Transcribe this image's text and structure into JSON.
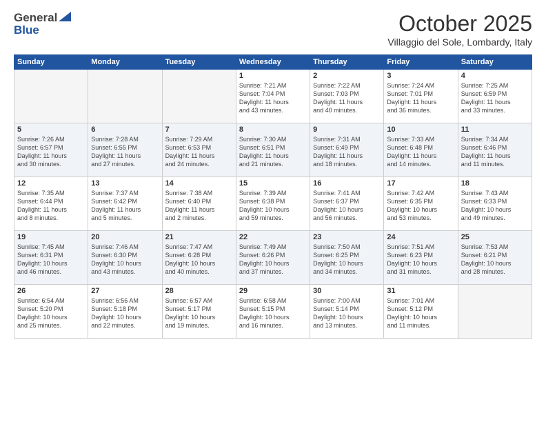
{
  "logo": {
    "line1": "General",
    "line2": "Blue"
  },
  "title": "October 2025",
  "subtitle": "Villaggio del Sole, Lombardy, Italy",
  "headers": [
    "Sunday",
    "Monday",
    "Tuesday",
    "Wednesday",
    "Thursday",
    "Friday",
    "Saturday"
  ],
  "weeks": [
    [
      {
        "num": "",
        "info": ""
      },
      {
        "num": "",
        "info": ""
      },
      {
        "num": "",
        "info": ""
      },
      {
        "num": "1",
        "info": "Sunrise: 7:21 AM\nSunset: 7:04 PM\nDaylight: 11 hours\nand 43 minutes."
      },
      {
        "num": "2",
        "info": "Sunrise: 7:22 AM\nSunset: 7:03 PM\nDaylight: 11 hours\nand 40 minutes."
      },
      {
        "num": "3",
        "info": "Sunrise: 7:24 AM\nSunset: 7:01 PM\nDaylight: 11 hours\nand 36 minutes."
      },
      {
        "num": "4",
        "info": "Sunrise: 7:25 AM\nSunset: 6:59 PM\nDaylight: 11 hours\nand 33 minutes."
      }
    ],
    [
      {
        "num": "5",
        "info": "Sunrise: 7:26 AM\nSunset: 6:57 PM\nDaylight: 11 hours\nand 30 minutes."
      },
      {
        "num": "6",
        "info": "Sunrise: 7:28 AM\nSunset: 6:55 PM\nDaylight: 11 hours\nand 27 minutes."
      },
      {
        "num": "7",
        "info": "Sunrise: 7:29 AM\nSunset: 6:53 PM\nDaylight: 11 hours\nand 24 minutes."
      },
      {
        "num": "8",
        "info": "Sunrise: 7:30 AM\nSunset: 6:51 PM\nDaylight: 11 hours\nand 21 minutes."
      },
      {
        "num": "9",
        "info": "Sunrise: 7:31 AM\nSunset: 6:49 PM\nDaylight: 11 hours\nand 18 minutes."
      },
      {
        "num": "10",
        "info": "Sunrise: 7:33 AM\nSunset: 6:48 PM\nDaylight: 11 hours\nand 14 minutes."
      },
      {
        "num": "11",
        "info": "Sunrise: 7:34 AM\nSunset: 6:46 PM\nDaylight: 11 hours\nand 11 minutes."
      }
    ],
    [
      {
        "num": "12",
        "info": "Sunrise: 7:35 AM\nSunset: 6:44 PM\nDaylight: 11 hours\nand 8 minutes."
      },
      {
        "num": "13",
        "info": "Sunrise: 7:37 AM\nSunset: 6:42 PM\nDaylight: 11 hours\nand 5 minutes."
      },
      {
        "num": "14",
        "info": "Sunrise: 7:38 AM\nSunset: 6:40 PM\nDaylight: 11 hours\nand 2 minutes."
      },
      {
        "num": "15",
        "info": "Sunrise: 7:39 AM\nSunset: 6:38 PM\nDaylight: 10 hours\nand 59 minutes."
      },
      {
        "num": "16",
        "info": "Sunrise: 7:41 AM\nSunset: 6:37 PM\nDaylight: 10 hours\nand 56 minutes."
      },
      {
        "num": "17",
        "info": "Sunrise: 7:42 AM\nSunset: 6:35 PM\nDaylight: 10 hours\nand 53 minutes."
      },
      {
        "num": "18",
        "info": "Sunrise: 7:43 AM\nSunset: 6:33 PM\nDaylight: 10 hours\nand 49 minutes."
      }
    ],
    [
      {
        "num": "19",
        "info": "Sunrise: 7:45 AM\nSunset: 6:31 PM\nDaylight: 10 hours\nand 46 minutes."
      },
      {
        "num": "20",
        "info": "Sunrise: 7:46 AM\nSunset: 6:30 PM\nDaylight: 10 hours\nand 43 minutes."
      },
      {
        "num": "21",
        "info": "Sunrise: 7:47 AM\nSunset: 6:28 PM\nDaylight: 10 hours\nand 40 minutes."
      },
      {
        "num": "22",
        "info": "Sunrise: 7:49 AM\nSunset: 6:26 PM\nDaylight: 10 hours\nand 37 minutes."
      },
      {
        "num": "23",
        "info": "Sunrise: 7:50 AM\nSunset: 6:25 PM\nDaylight: 10 hours\nand 34 minutes."
      },
      {
        "num": "24",
        "info": "Sunrise: 7:51 AM\nSunset: 6:23 PM\nDaylight: 10 hours\nand 31 minutes."
      },
      {
        "num": "25",
        "info": "Sunrise: 7:53 AM\nSunset: 6:21 PM\nDaylight: 10 hours\nand 28 minutes."
      }
    ],
    [
      {
        "num": "26",
        "info": "Sunrise: 6:54 AM\nSunset: 5:20 PM\nDaylight: 10 hours\nand 25 minutes."
      },
      {
        "num": "27",
        "info": "Sunrise: 6:56 AM\nSunset: 5:18 PM\nDaylight: 10 hours\nand 22 minutes."
      },
      {
        "num": "28",
        "info": "Sunrise: 6:57 AM\nSunset: 5:17 PM\nDaylight: 10 hours\nand 19 minutes."
      },
      {
        "num": "29",
        "info": "Sunrise: 6:58 AM\nSunset: 5:15 PM\nDaylight: 10 hours\nand 16 minutes."
      },
      {
        "num": "30",
        "info": "Sunrise: 7:00 AM\nSunset: 5:14 PM\nDaylight: 10 hours\nand 13 minutes."
      },
      {
        "num": "31",
        "info": "Sunrise: 7:01 AM\nSunset: 5:12 PM\nDaylight: 10 hours\nand 11 minutes."
      },
      {
        "num": "",
        "info": ""
      }
    ]
  ]
}
